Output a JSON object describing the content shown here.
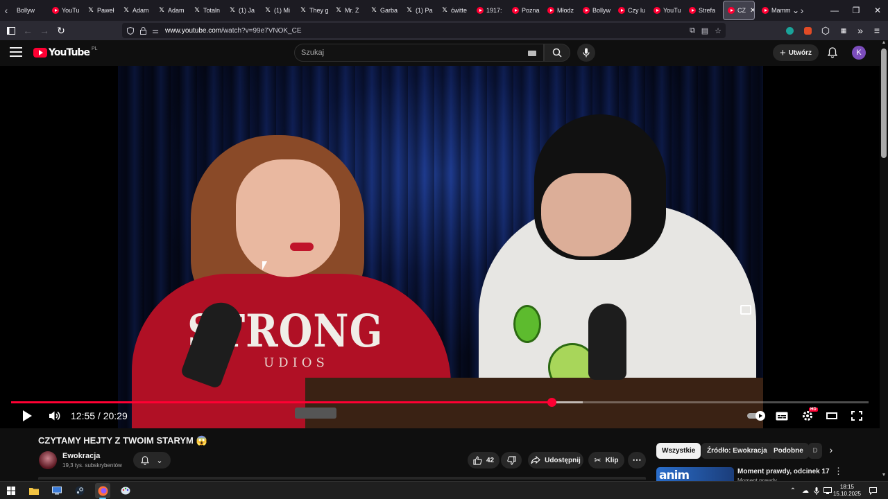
{
  "browser": {
    "tabs": [
      {
        "label": "Bollyw",
        "icon": "none"
      },
      {
        "label": "YouTu",
        "icon": "youtube"
      },
      {
        "label": "Paweł",
        "icon": "x"
      },
      {
        "label": "Adam",
        "icon": "x"
      },
      {
        "label": "Adam",
        "icon": "x"
      },
      {
        "label": "Totaln",
        "icon": "x"
      },
      {
        "label": "(1) Ja",
        "icon": "x"
      },
      {
        "label": "(1) Mi",
        "icon": "x"
      },
      {
        "label": "They g",
        "icon": "x"
      },
      {
        "label": "Mr. Ż",
        "icon": "x"
      },
      {
        "label": "Garba",
        "icon": "x"
      },
      {
        "label": "(1) Pa",
        "icon": "x"
      },
      {
        "label": "ćwitte",
        "icon": "x"
      },
      {
        "label": "1917:",
        "icon": "youtube"
      },
      {
        "label": "Pozna",
        "icon": "youtube"
      },
      {
        "label": "Młodz",
        "icon": "youtube"
      },
      {
        "label": "Bollyw",
        "icon": "youtube"
      },
      {
        "label": "Czy lu",
        "icon": "youtube"
      },
      {
        "label": "YouTu",
        "icon": "youtube"
      },
      {
        "label": "Strefa",
        "icon": "youtube"
      },
      {
        "label": "CZ",
        "icon": "youtube",
        "active": true
      },
      {
        "label": "Mamm",
        "icon": "youtube"
      }
    ],
    "url_domain": "www.youtube.com",
    "url_path": "/watch?v=99e7VNOK_CE"
  },
  "masthead": {
    "logo_text": "YouTube",
    "country_code": "PL",
    "search_placeholder": "Szukaj",
    "create_label": "Utwórz",
    "avatar_letter": "K",
    "avatar_color": "#7c4dbc"
  },
  "video": {
    "shirt_text": "STRONG",
    "shirt_subtext": "UDIOS",
    "current_time": "12:55",
    "duration": "20:29",
    "time_display": "12:55 / 20:29",
    "progress_fraction": 0.63,
    "buffered_fraction": 0.667,
    "hd_badge": "HD",
    "accent_color": "#ff0033"
  },
  "details": {
    "title": "CZYTAMY HEJTY Z TWOIM STARYM 😱",
    "channel_name": "Ewokracja",
    "subscribers": "19,3 tys. subskrybentów",
    "likes": "42",
    "share_label": "Udostępnij",
    "clip_label": "Klip"
  },
  "sidebar": {
    "chips": [
      "Wszystkie",
      "Źródło: Ewokracja",
      "Podobne",
      "D"
    ],
    "recommendation": {
      "thumb_text": "anim",
      "title": "Moment prawdy, odcinek 17",
      "channel": "Moment prawdy"
    }
  },
  "taskbar": {
    "time": "18:15",
    "date": "15.10.2025"
  }
}
